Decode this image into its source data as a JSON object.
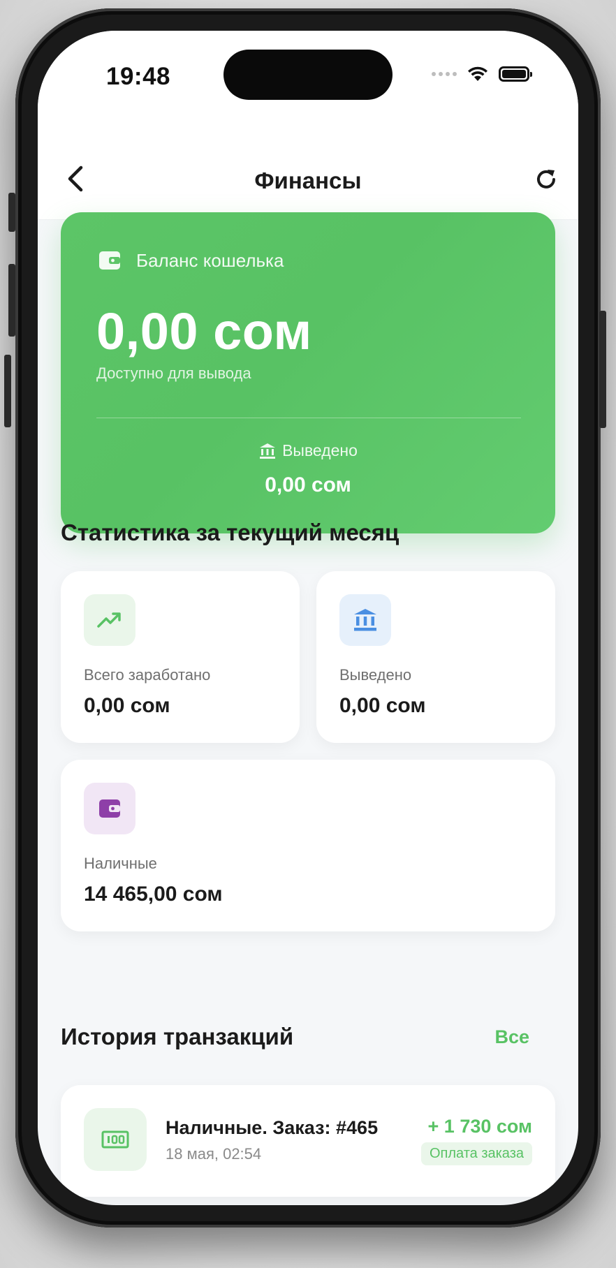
{
  "status_bar": {
    "time": "19:48"
  },
  "nav": {
    "title": "Финансы"
  },
  "balance_card": {
    "label": "Баланс кошелька",
    "amount": "0,00 сом",
    "sublabel": "Доступно для вывода",
    "withdrawn_label": "Выведено",
    "withdrawn_amount": "0,00 сом"
  },
  "stats": {
    "title": "Статистика за текущий месяц",
    "earned": {
      "label": "Всего заработано",
      "value": "0,00 сом",
      "icon": "trending-up-icon"
    },
    "withdrawn": {
      "label": "Выведено",
      "value": "0,00 сом",
      "icon": "bank-icon"
    },
    "cash": {
      "label": "Наличные",
      "value": "14 465,00 сом",
      "icon": "wallet-icon"
    }
  },
  "history": {
    "title": "История транзакций",
    "see_all": "Все",
    "items": [
      {
        "title": "Наличные. Заказ: #465",
        "date": "18 мая, 02:54",
        "amount": "+ 1 730 сом",
        "type": "Оплата заказа",
        "icon": "cash-icon"
      }
    ]
  },
  "colors": {
    "accent": "#58c264",
    "earned_icon_bg": "#eaf6ea",
    "withdrawn_icon_bg": "#e6f0fb",
    "withdrawn_icon": "#4a8fe2",
    "cash_icon_bg": "#f1e6f5",
    "cash_icon": "#8e3fa8"
  }
}
